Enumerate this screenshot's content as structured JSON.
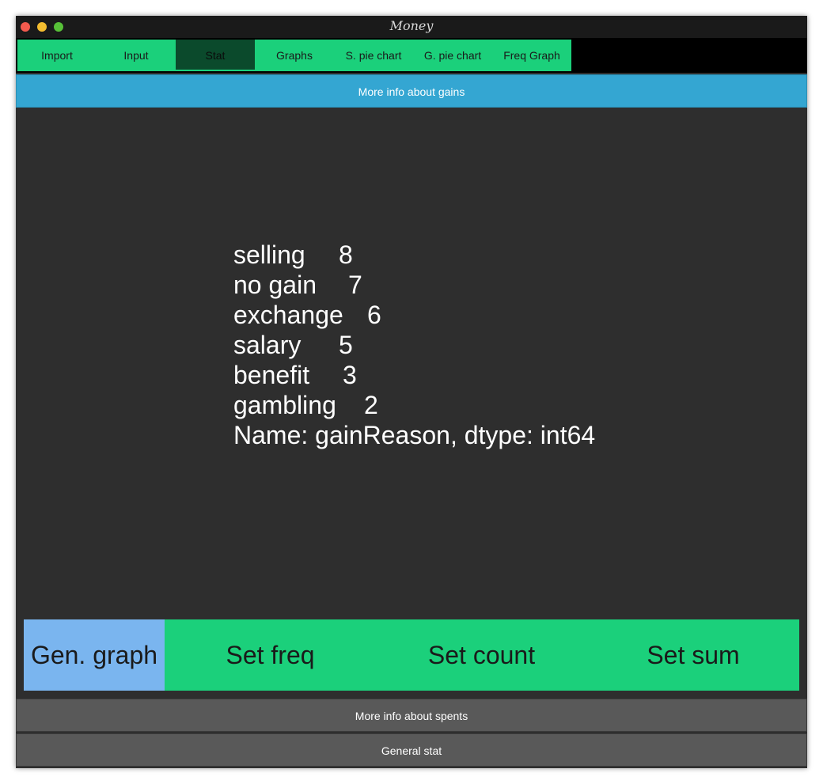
{
  "window": {
    "title": "Money"
  },
  "tabs": [
    {
      "label": "Import",
      "active": false
    },
    {
      "label": "Input",
      "active": false
    },
    {
      "label": "Stat",
      "active": true
    },
    {
      "label": "Graphs",
      "active": false
    },
    {
      "label": "S. pie chart",
      "active": false
    },
    {
      "label": "G. pie chart",
      "active": false
    },
    {
      "label": "Freq Graph",
      "active": false
    }
  ],
  "gains_button": {
    "label": "More info about gains"
  },
  "stats": {
    "rows": [
      {
        "label": "selling",
        "value": "8"
      },
      {
        "label": "no gain",
        "value": "7"
      },
      {
        "label": "exchange",
        "value": "6"
      },
      {
        "label": "salary",
        "value": "5"
      },
      {
        "label": "benefit",
        "value": "3"
      },
      {
        "label": "gambling",
        "value": "2"
      }
    ],
    "footer": "Name: gainReason, dtype: int64"
  },
  "actions": {
    "gen_graph": "Gen. graph",
    "set_freq": "Set freq",
    "set_count": "Set count",
    "set_sum": "Set sum"
  },
  "spents_button": {
    "label": "More info about spents"
  },
  "general_button": {
    "label": "General stat"
  },
  "colors": {
    "tab_green": "#1bd07b",
    "tab_active": "#0b4a2c",
    "info_blue": "#34a6d2",
    "gen_graph_blue": "#7ab5ef",
    "content_bg": "#2e2e2e",
    "footer_gray": "#595959"
  }
}
